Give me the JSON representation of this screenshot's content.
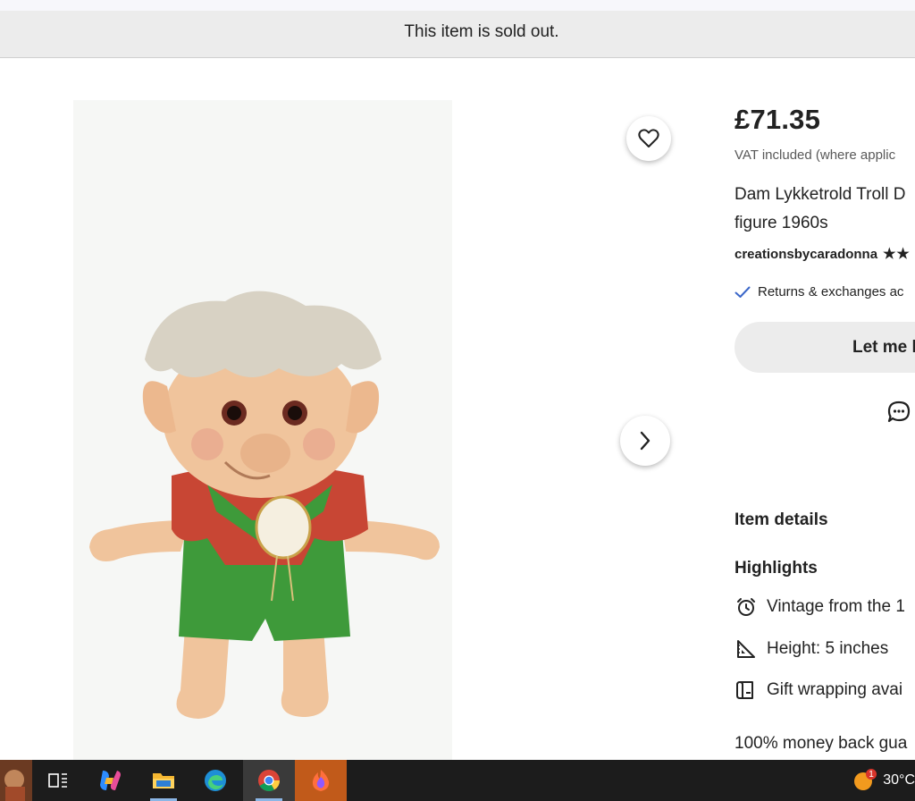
{
  "banner": {
    "sold_out_text": "This item is sold out."
  },
  "gallery": {
    "favorite_icon": "heart-outline-icon",
    "next_icon": "chevron-right-icon"
  },
  "product": {
    "price": "£71.35",
    "vat_text": "VAT included (where applic",
    "title_line1": "Dam Lykketrold Troll D",
    "title_line2": "figure 1960s",
    "shop_name": "creationsbycaradonna",
    "stars": "★★",
    "returns_text": "Returns & exchanges ac",
    "cta_label": "Let me k",
    "message_icon": "chat-bubble-icon"
  },
  "details": {
    "item_details_label": "Item details",
    "highlights_label": "Highlights",
    "highlights": [
      {
        "icon": "alarm-clock-icon",
        "text": "Vintage from the 1"
      },
      {
        "icon": "ruler-triangle-icon",
        "text": "Height: 5 inches"
      },
      {
        "icon": "gift-scroll-icon",
        "text": "Gift wrapping avai"
      }
    ],
    "money_back_text": "100% money back gua"
  },
  "taskbar": {
    "apps": [
      "profile-thumbnail",
      "task-view-icon",
      "copilot-icon",
      "file-explorer-icon",
      "edge-icon",
      "chrome-icon",
      "firefox-icon"
    ],
    "weather_badge": "1",
    "temperature": "30°C"
  },
  "colors": {
    "sold_bar": "#ececec",
    "check_blue": "#3b67c9",
    "taskbar": "#1c1c1c"
  }
}
